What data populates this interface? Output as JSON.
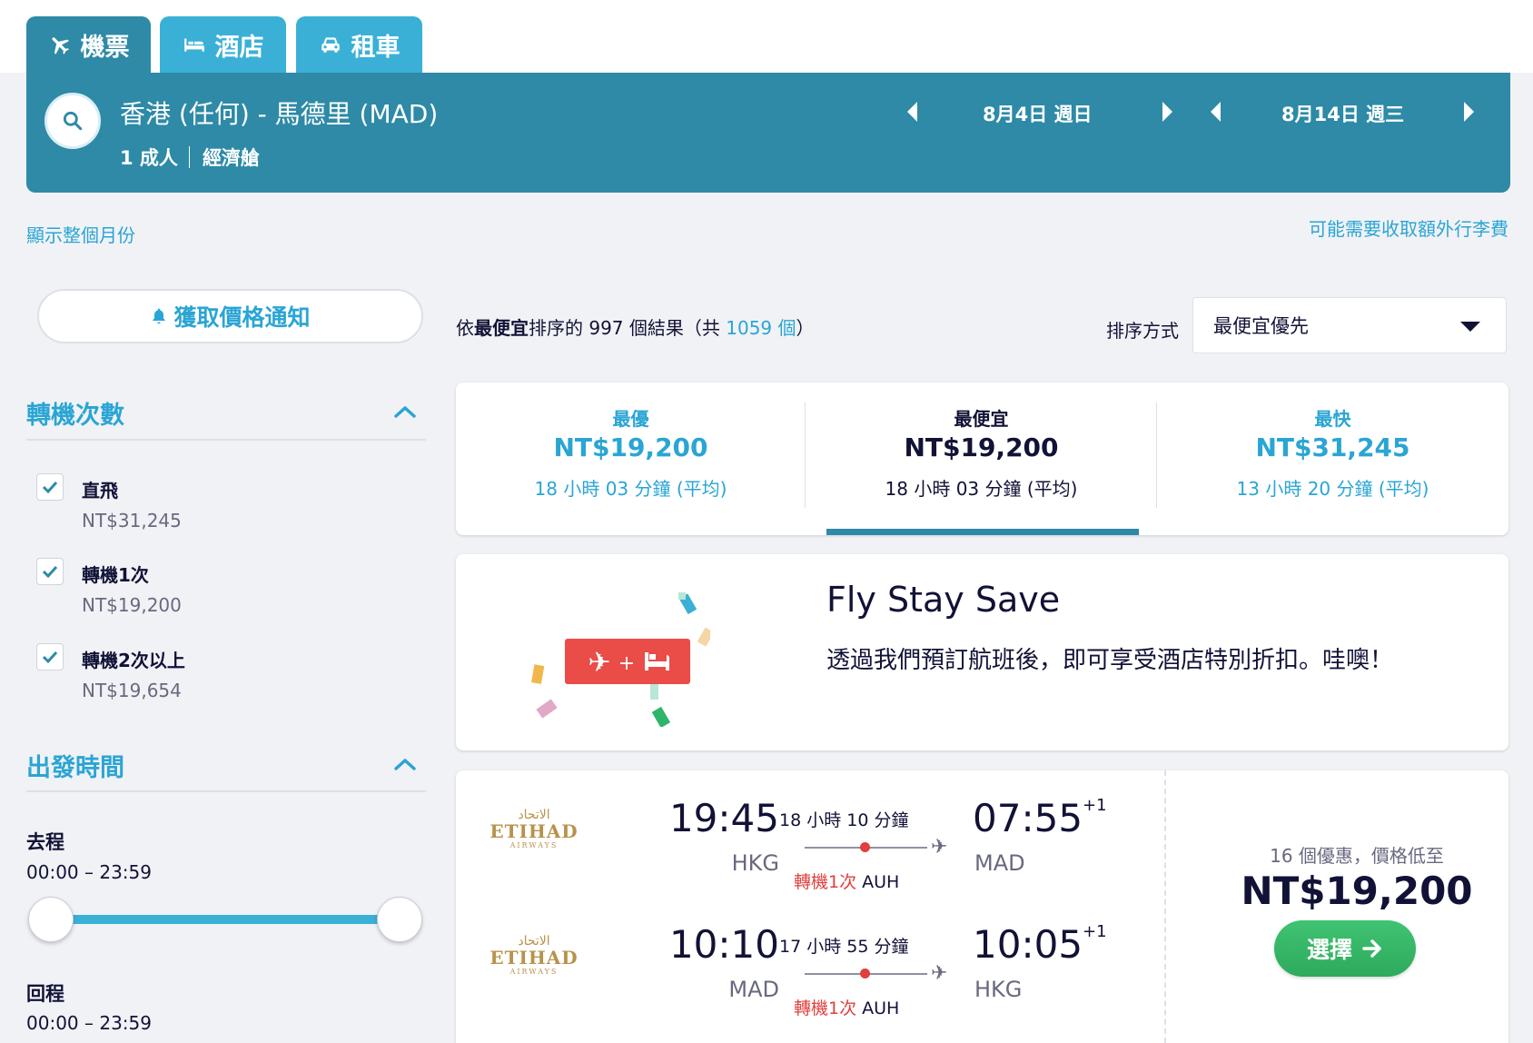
{
  "tabs": [
    {
      "label": "機票",
      "icon": "plane-icon",
      "active": true
    },
    {
      "label": "酒店",
      "icon": "bed-icon",
      "active": false
    },
    {
      "label": "租車",
      "icon": "car-icon",
      "active": false
    }
  ],
  "search": {
    "route": "香港 (任何) - 馬德里 (MAD)",
    "passengers": "1 成人",
    "cabin": "經濟艙",
    "depart_date": "8月4日 週日",
    "return_date": "8月14日 週三"
  },
  "links": {
    "show_month": "顯示整個月份",
    "baggage_fee": "可能需要收取額外行李費"
  },
  "sidebar": {
    "price_alert": "獲取價格通知",
    "stops_title": "轉機次數",
    "stops": [
      {
        "label": "直飛",
        "price": "NT$31,245",
        "checked": true
      },
      {
        "label": "轉機1次",
        "price": "NT$19,200",
        "checked": true
      },
      {
        "label": "轉機2次以上",
        "price": "NT$19,654",
        "checked": true
      }
    ],
    "departure_title": "出發時間",
    "outbound_label": "去程",
    "outbound_range": "00:00 – 23:59",
    "return_label": "回程",
    "return_range": "00:00 – 23:59"
  },
  "results": {
    "prefix": "依",
    "sort_word": "最便宜",
    "middle": "排序的 997 個結果（共 ",
    "total": "1059 個",
    "suffix": "）",
    "sort_label": "排序方式",
    "sort_value": "最便宜優先"
  },
  "summary": [
    {
      "title": "最優",
      "price": "NT$19,200",
      "duration": "18 小時 03 分鐘 (平均)"
    },
    {
      "title": "最便宜",
      "price": "NT$19,200",
      "duration": "18 小時 03 分鐘 (平均)"
    },
    {
      "title": "最快",
      "price": "NT$31,245",
      "duration": "13 小時 20 分鐘 (平均)"
    }
  ],
  "promo": {
    "title": "Fly Stay Save",
    "text": "透過我們預訂航班後，即可享受酒店特別折扣。哇噢！"
  },
  "flight": {
    "airline_ar": "الاتحاد",
    "airline_en": "ETIHAD",
    "airline_sub": "AIRWAYS",
    "legs": [
      {
        "dep_time": "19:45",
        "dep_airport": "HKG",
        "duration": "18 小時 10 分鐘",
        "stops": "轉機1次",
        "via": "AUH",
        "arr_time": "07:55",
        "day_offset": "+1",
        "arr_airport": "MAD"
      },
      {
        "dep_time": "10:10",
        "dep_airport": "MAD",
        "duration": "17 小時 55 分鐘",
        "stops": "轉機1次",
        "via": "AUH",
        "arr_time": "10:05",
        "day_offset": "+1",
        "arr_airport": "HKG"
      }
    ],
    "deals": "16 個優惠，價格低至",
    "price": "NT$19,200",
    "select_label": "選擇"
  },
  "colors": {
    "header": "#2e8aa6",
    "tab_inactive": "#3bb0d6",
    "accent_blue": "#2aa5d4",
    "select_green": "#3fc372",
    "stop_red": "#e0403e"
  }
}
